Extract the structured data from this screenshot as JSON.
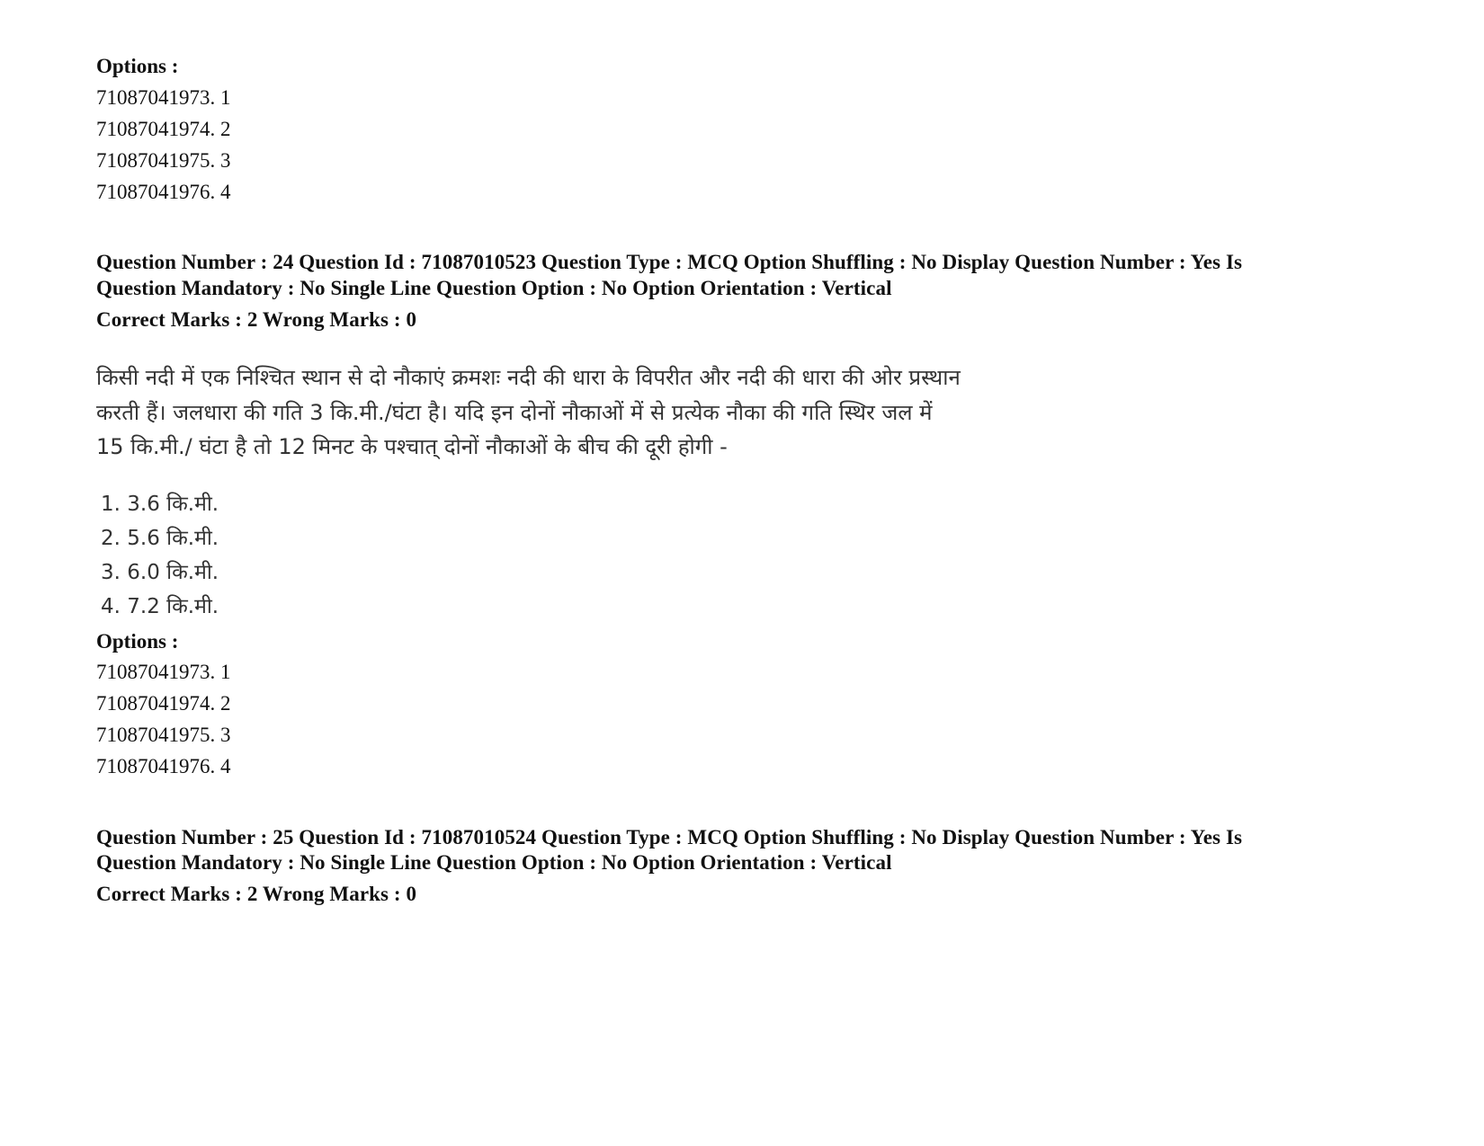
{
  "top_options": {
    "label": "Options :",
    "items": [
      "71087041973. 1",
      "71087041974. 2",
      "71087041975. 3",
      "71087041976. 4"
    ]
  },
  "question_24": {
    "meta_line_1": "Question Number : 24 Question Id : 71087010523 Question Type : MCQ Option Shuffling : No Display Question Number : Yes Is",
    "meta_line_2": "Question Mandatory : No Single Line Question Option : No Option Orientation : Vertical",
    "marks_line": "Correct Marks : 2 Wrong Marks : 0",
    "question_lines": [
      "किसी नदी में एक निश्चित स्थान से दो नौकाएं क्रमशः नदी की धारा के विपरीत और नदी की धारा की ओर प्रस्थान",
      "करती हैं। जलधारा की गति 3 कि.मी./घंटा है। यदि इन दोनों नौकाओं में से प्रत्येक नौका की गति  स्थिर जल में",
      "15 कि.मी./ घंटा है तो 12 मिनट के पश्चात् दोनों नौकाओं के बीच की दूरी होगी -"
    ],
    "answer_choices": [
      "1. 3.6 कि.मी.",
      "2. 5.6 कि.मी.",
      "3. 6.0 कि.मी.",
      "4. 7.2 कि.मी."
    ],
    "options_label": "Options :",
    "options": [
      "71087041973. 1",
      "71087041974. 2",
      "71087041975. 3",
      "71087041976. 4"
    ]
  },
  "question_25": {
    "meta_line_1": "Question Number : 25 Question Id : 71087010524 Question Type : MCQ Option Shuffling : No Display Question Number : Yes Is",
    "meta_line_2": "Question Mandatory : No Single Line Question Option : No Option Orientation : Vertical",
    "marks_line": "Correct Marks : 2 Wrong Marks : 0"
  }
}
